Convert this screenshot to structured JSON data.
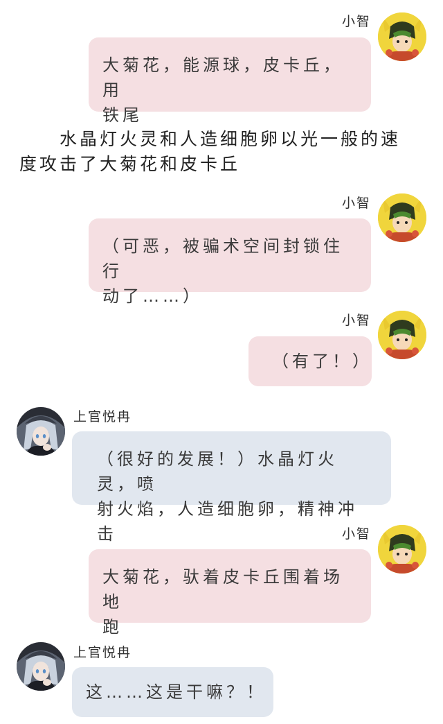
{
  "users": {
    "xiaozhi": {
      "name": "小智",
      "avatar_icon": "pikachu-hood-avatar-icon"
    },
    "shangguan": {
      "name": "上官悦冉",
      "avatar_icon": "silver-hair-girl-avatar-icon"
    }
  },
  "colors": {
    "pink_bubble": "#f5dfe2",
    "blue_bubble": "#e1e7ef"
  },
  "messages": [
    {
      "sender": "小智",
      "text": "大菊花，能源球，皮卡丘，用\n铁尾"
    },
    {
      "type": "narration",
      "text": "　　水晶灯火灵和人造细胞卵以光一般的速\n度攻击了大菊花和皮卡丘"
    },
    {
      "sender": "小智",
      "text": "（可恶，被骗术空间封锁住行\n动了……）"
    },
    {
      "sender": "小智",
      "text": "（有了！）"
    },
    {
      "sender": "上官悦冉",
      "text": "（很好的发展！）水晶灯火灵，喷\n射火焰，人造细胞卵，精神冲击"
    },
    {
      "sender": "小智",
      "text": "大菊花，驮着皮卡丘围着场地\n跑"
    },
    {
      "sender": "上官悦冉",
      "text": "这……这是干嘛？！"
    }
  ]
}
